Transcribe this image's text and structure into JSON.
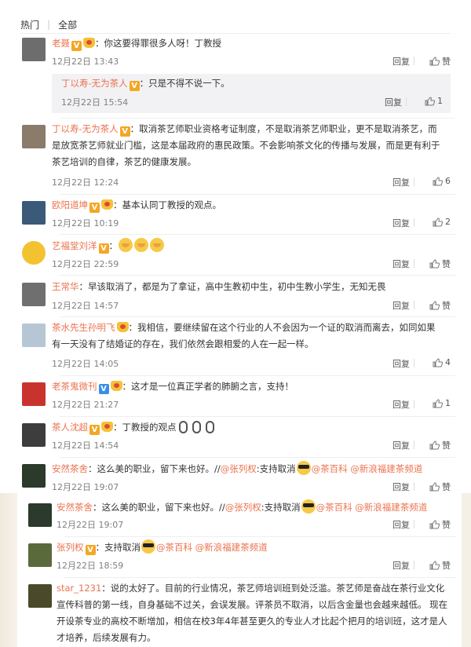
{
  "tabs": {
    "hot": "热门",
    "all": "全部"
  },
  "labels": {
    "reply": "回复",
    "like": "赞"
  },
  "comments": [
    {
      "name": "老聂",
      "text": "：你这要得罪很多人呀！丁教授",
      "time": "12月22日 13:43",
      "like": "赞"
    },
    {
      "name": "丁以寿-无为茶人",
      "text": "：只是不得不说一下。",
      "time": "12月22日 15:54",
      "like": "1"
    },
    {
      "name": "丁以寿-无为茶人",
      "text": "：取消茶艺师职业资格考证制度，不是取消茶艺师职业，更不是取消茶艺，而",
      "text2": "是放宽茶艺师就业门槛，这是本届政府的惠民政策。不会影响茶文化的传播与发展，而是更有利于",
      "text3": "茶艺培训的自律，茶艺的健康发展。",
      "time": "12月22日 12:24",
      "like": "6"
    },
    {
      "name": "欧阳道坤",
      "text": "：基本认同丁教授的观点。",
      "time": "12月22日 10:19",
      "like": "2"
    },
    {
      "name": "艺福堂刘洋",
      "text": "：",
      "time": "12月22日 22:59",
      "like": "赞"
    },
    {
      "name": "王常华",
      "text": "：早该取消了，都是为了拿证，高中生教初中生，初中生教小学生，无知无畏",
      "time": "12月22日 14:57",
      "like": "赞"
    },
    {
      "name": "茶水先生孙明飞",
      "text": "：我相信，要继续留在这个行业的人不会因为一个证的取消而离去，如同如果",
      "text2": "有一天没有了结婚证的存在，我们依然会跟相爱的人在一起一样。",
      "time": "12月22日 14:05",
      "like": "4"
    },
    {
      "name": "老茶鬼微刊",
      "text": "：这才是一位真正学者的肺腑之言，支持！",
      "time": "12月22日 21:27",
      "like": "1"
    },
    {
      "name": "茶人沈超",
      "text": "：丁教授的观点",
      "time": "12月22日 14:54",
      "like": "赞"
    },
    {
      "name": "安然茶舍",
      "text": "：这么美的职业，留下来也好。//",
      "mention": "@张列权",
      "text_b": ":支持取消",
      "tag1": "@茶百科",
      "tag2": "@新浪福建茶频道",
      "time": "12月22日 19:07",
      "like": "赞"
    },
    {
      "name": "安然茶舍",
      "text": "：这么美的职业，留下来也好。//",
      "mention": "@张列权",
      "text_b": ":支持取消",
      "tag1": "@茶百科",
      "tag2": "@新浪福建茶频道",
      "time": "12月22日 19:07",
      "like": "赞"
    },
    {
      "name": "张列权",
      "text": "：支持取消",
      "tag1": "@茶百科",
      "tag2": "@新浪福建茶频道",
      "time": "12月22日 18:59",
      "like": "赞"
    },
    {
      "name": "star_1231",
      "text": "：说的太好了。目前的行业情况，茶艺师培训班到处泛滥。茶艺师是奋战在茶行业文化",
      "text2": "宣传科普的第一线，自身基础不过关，会误发展。评茶员不取消，以后含金量也会越来越低。 现在",
      "text3": "开设茶专业的高校不断增加，相信在校3年4年甚至更久的专业人才比起个把月的培训班，这才是人",
      "text4": "才培养，后续发展有力。"
    }
  ]
}
